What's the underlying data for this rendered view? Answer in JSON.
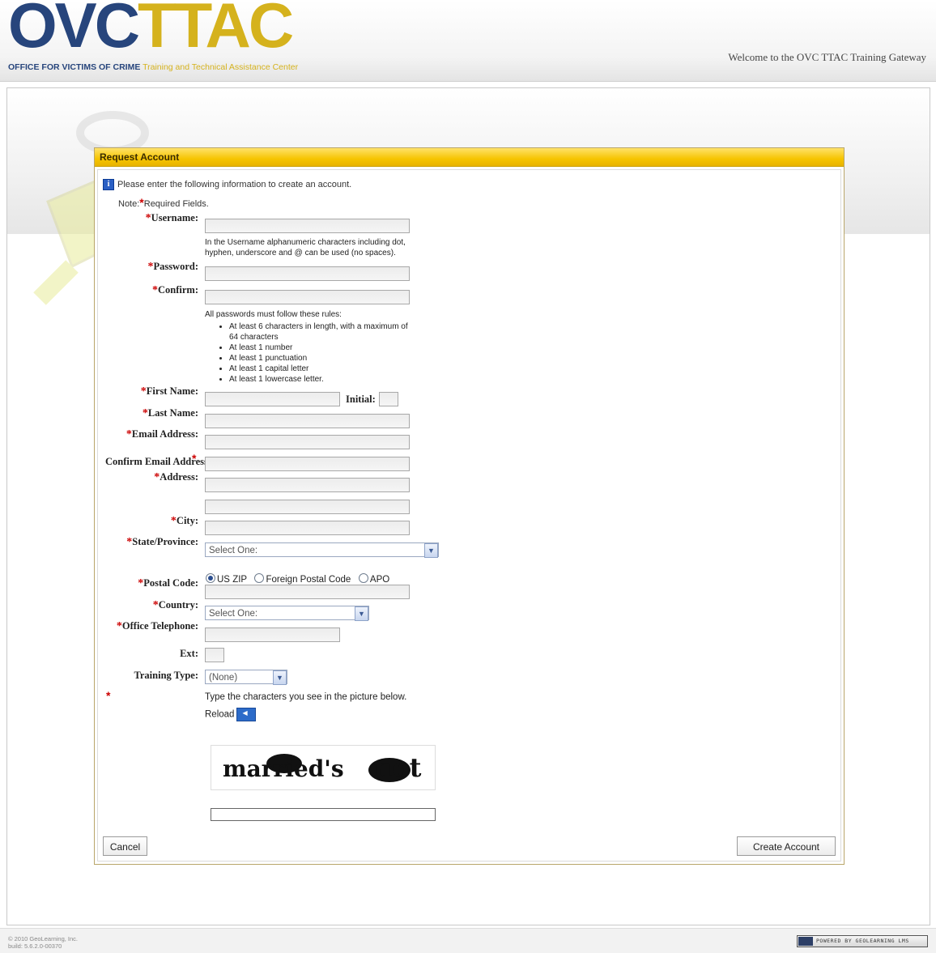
{
  "header": {
    "logo_ovc": "OVC",
    "logo_ttac": "TTAC",
    "logo_sub_a": "OFFICE FOR VICTIMS OF CRIME",
    "logo_sub_b": "Training and Technical Assistance Center",
    "welcome": "Welcome to the OVC TTAC Training Gateway"
  },
  "panel": {
    "title": "Request Account",
    "info": "Please enter the following information to create an account.",
    "note_prefix": "Note:",
    "note_suffix": "Required Fields."
  },
  "required_mark": "*",
  "form": {
    "username_label": "Username:",
    "username_help": "In the Username alphanumeric characters including dot, hyphen, underscore and @ can be used (no spaces).",
    "password_label": "Password:",
    "confirm_label": "Confirm:",
    "rules_intro": "All passwords must follow these rules:",
    "rules": [
      "At least 6 characters in length, with a maximum of 64 characters",
      "At least 1 number",
      "At least 1 punctuation",
      "At least 1 capital letter",
      "At least 1 lowercase letter."
    ],
    "first_name_label": "First Name:",
    "initial_label": "Initial:",
    "last_name_label": "Last Name:",
    "email_label": "Email Address:",
    "confirm_email_label": "Confirm Email Address:",
    "address_label": "Address:",
    "city_label": "City:",
    "state_label": "State/Province:",
    "state_value": "Select One:",
    "zip_options": [
      "US",
      "ZIP",
      "Foreign Postal Code",
      "APO"
    ],
    "postal_label": "Postal Code:",
    "country_label": "Country:",
    "country_value": "Select One:",
    "phone_label": "Office Telephone:",
    "ext_label": "Ext:",
    "training_label": "Training Type:",
    "training_value": "(None)",
    "captcha_prompt": "Type the characters you see in the picture below.",
    "reload": "Reload",
    "captcha_text": [
      "married's",
      "not"
    ]
  },
  "buttons": {
    "cancel": "Cancel",
    "create": "Create Account"
  },
  "footer": {
    "copyright": "© 2010 GeoLearning, Inc.",
    "build": "build: 5.6.2.0-00370",
    "powered": "POWERED BY GEOLEARNING LMS"
  }
}
